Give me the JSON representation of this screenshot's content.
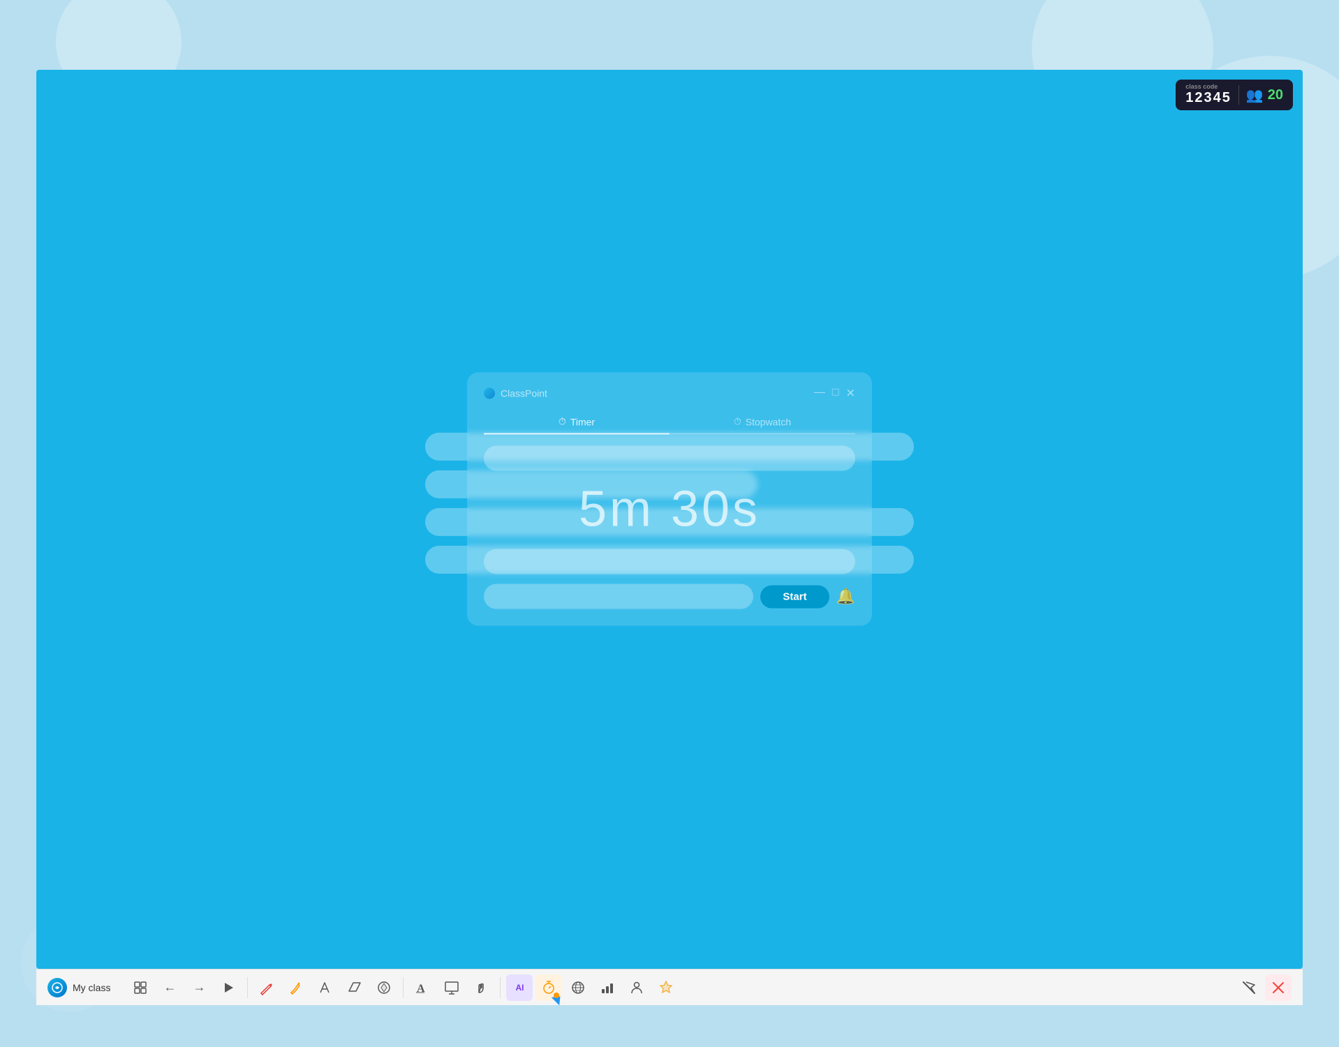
{
  "background": {
    "color": "#b8dff0"
  },
  "class_code_badge": {
    "label": "class\ncode",
    "code": "12345",
    "students_count": "20"
  },
  "timer_popup": {
    "title": "ClassPoint",
    "timer_tab": "Timer",
    "stopwatch_tab": "Stopwatch",
    "time_display": "5m 30s",
    "start_button": "Start"
  },
  "toolbar": {
    "class_name": "My class",
    "nav": {
      "back": "←",
      "forward": "→"
    },
    "buttons": [
      {
        "name": "grid-view",
        "icon": "⊞",
        "label": "Grid View"
      },
      {
        "name": "back-nav",
        "icon": "←",
        "label": "Back"
      },
      {
        "name": "forward-nav",
        "icon": "→",
        "label": "Forward"
      },
      {
        "name": "play",
        "icon": "▶",
        "label": "Play"
      },
      {
        "name": "pen",
        "icon": "✏",
        "label": "Pen"
      },
      {
        "name": "highlighter",
        "icon": "🖊",
        "label": "Highlighter"
      },
      {
        "name": "pen-variant",
        "icon": "✒",
        "label": "Pen Variant"
      },
      {
        "name": "eraser",
        "icon": "◇",
        "label": "Eraser"
      },
      {
        "name": "shapes",
        "icon": "⬡",
        "label": "Shapes"
      },
      {
        "name": "text",
        "icon": "A",
        "label": "Text"
      },
      {
        "name": "whiteboard",
        "icon": "⬜",
        "label": "Whiteboard"
      },
      {
        "name": "hand",
        "icon": "✋",
        "label": "Hand Raise"
      },
      {
        "name": "ai",
        "icon": "AI",
        "label": "AI"
      },
      {
        "name": "timer",
        "icon": "⏱",
        "label": "Timer"
      },
      {
        "name": "browser",
        "icon": "🌐",
        "label": "Browser"
      },
      {
        "name": "activities",
        "icon": "📊",
        "label": "Activities"
      },
      {
        "name": "participants",
        "icon": "👤",
        "label": "Participants"
      },
      {
        "name": "leaderboard",
        "icon": "🏆",
        "label": "Leaderboard"
      },
      {
        "name": "hide-pointer",
        "icon": "↗",
        "label": "Hide Pointer"
      },
      {
        "name": "exit",
        "icon": "✕",
        "label": "Exit"
      }
    ]
  }
}
